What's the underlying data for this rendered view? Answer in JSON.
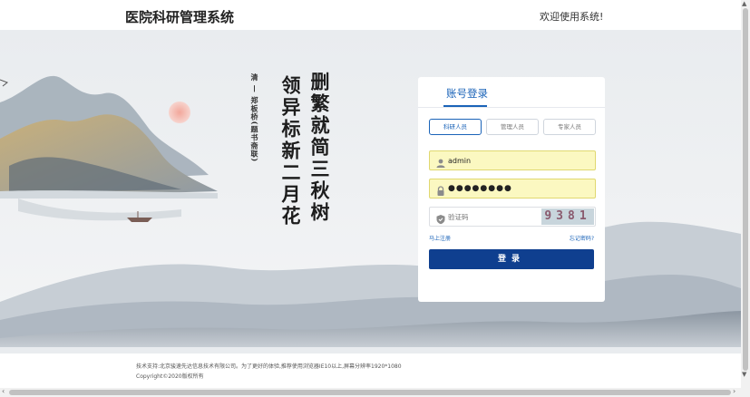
{
  "header": {
    "logo": "医院科研管理系统",
    "welcome": "欢迎使用系统!"
  },
  "poem": {
    "line1": "删繁就简三秋树",
    "line2": "领异标新二月花",
    "signature": "清 — 郑板桥(题书斋联)"
  },
  "login": {
    "tab_label": "账号登录",
    "roles": [
      "科研人员",
      "管理人员",
      "专家人员"
    ],
    "active_role": 0,
    "username": "admin",
    "password": "●●●●●●●●",
    "captcha_placeholder": "验证码",
    "captcha_code": "9381",
    "register_link": "马上注册",
    "forgot_link": "忘记密码?",
    "submit_label": "登录"
  },
  "footer": {
    "support": "技术支持:北京骏速先达信息技术有限公司。为了更好的体验,推荐使用浏览器IE10以上,屏幕分辨率1920*1080",
    "copyright": "Copyright©2020版权所有"
  },
  "icons": {
    "user": "user-icon",
    "lock": "lock-icon",
    "shield": "shield-icon"
  },
  "colors": {
    "accent": "#1a63b8",
    "button": "#0f3f8f",
    "autofill": "#fbf8c1"
  }
}
